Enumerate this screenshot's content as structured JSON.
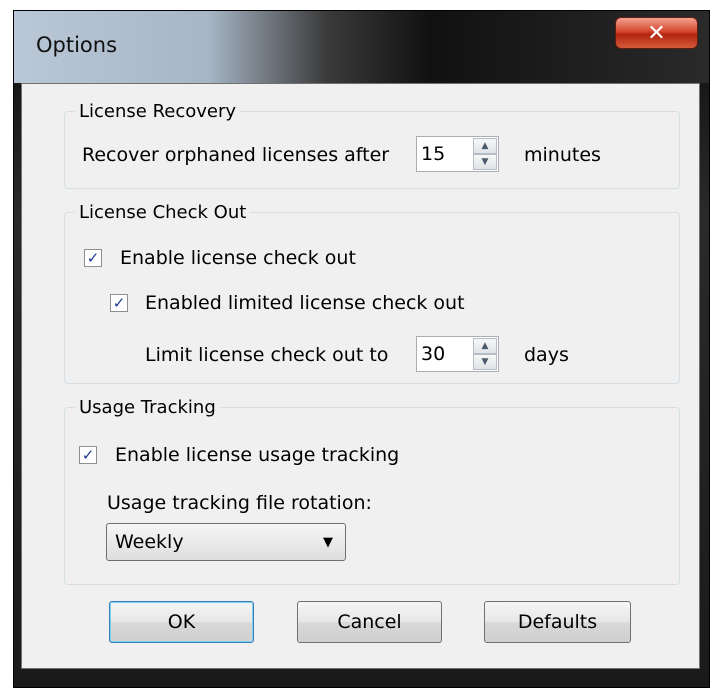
{
  "window": {
    "title": "Options",
    "close_label": "✕"
  },
  "license_recovery": {
    "legend": "License Recovery",
    "label": "Recover orphaned licenses after",
    "value": "15",
    "unit": "minutes"
  },
  "license_checkout": {
    "legend": "License Check Out",
    "enable_label": "Enable license check out",
    "enable_checked": true,
    "limited_label": "Enabled limited license check out",
    "limited_checked": true,
    "limit_label": "Limit license check out to",
    "limit_value": "30",
    "limit_unit": "days"
  },
  "usage_tracking": {
    "legend": "Usage Tracking",
    "enable_label": "Enable license usage tracking",
    "enable_checked": true,
    "rotation_label": "Usage tracking file rotation:",
    "rotation_value": "Weekly"
  },
  "buttons": {
    "ok": "OK",
    "cancel": "Cancel",
    "defaults": "Defaults"
  },
  "icons": {
    "check": "✓",
    "arrow_up": "▲",
    "arrow_down": "▼",
    "dropdown": "▼"
  }
}
